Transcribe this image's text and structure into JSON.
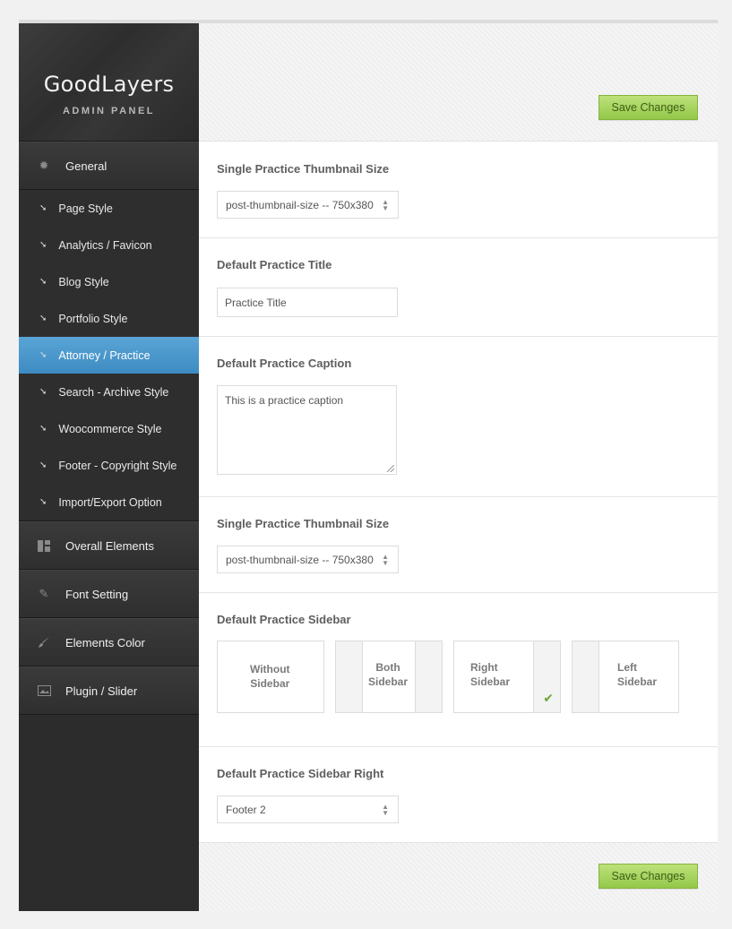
{
  "brand": {
    "title": "GoodLayers",
    "subtitle": "ADMIN PANEL"
  },
  "sidebar": {
    "general": {
      "label": "General",
      "icon": "gear-icon"
    },
    "sub_items": [
      {
        "label": "Page Style"
      },
      {
        "label": "Analytics / Favicon"
      },
      {
        "label": "Blog Style"
      },
      {
        "label": "Portfolio Style"
      },
      {
        "label": "Attorney / Practice",
        "active": true
      },
      {
        "label": "Search - Archive Style"
      },
      {
        "label": "Woocommerce Style"
      },
      {
        "label": "Footer - Copyright Style"
      },
      {
        "label": "Import/Export Option"
      }
    ],
    "sections": [
      {
        "label": "Overall Elements",
        "icon": "layout-icon"
      },
      {
        "label": "Font Setting",
        "icon": "pencil-icon"
      },
      {
        "label": "Elements Color",
        "icon": "brush-icon"
      },
      {
        "label": "Plugin / Slider",
        "icon": "slider-icon"
      }
    ]
  },
  "toolbar": {
    "save_label": "Save Changes"
  },
  "options": {
    "thumb1": {
      "label": "Single Practice Thumbnail Size",
      "value": "post-thumbnail-size -- 750x380"
    },
    "title": {
      "label": "Default Practice Title",
      "value": "Practice Title"
    },
    "caption": {
      "label": "Default Practice Caption",
      "value": "This is a practice caption"
    },
    "thumb2": {
      "label": "Single Practice Thumbnail Size",
      "value": "post-thumbnail-size -- 750x380"
    },
    "sidebar": {
      "label": "Default Practice Sidebar",
      "choices": [
        {
          "line1": "Without",
          "line2": "Sidebar"
        },
        {
          "line1": "Both",
          "line2": "Sidebar"
        },
        {
          "line1": "Right",
          "line2": "Sidebar",
          "selected": true
        },
        {
          "line1": "Left",
          "line2": "Sidebar"
        }
      ]
    },
    "sidebar_right": {
      "label": "Default Practice Sidebar Right",
      "value": "Footer 2"
    }
  },
  "colors": {
    "accent": "#4a97cc",
    "button": "#a8d562",
    "sidebar": "#2c2c2c",
    "check": "#6aa735"
  }
}
